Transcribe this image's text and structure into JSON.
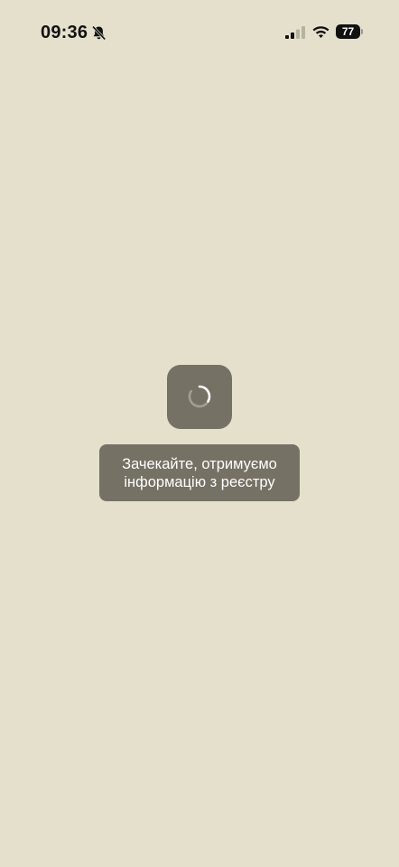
{
  "status_bar": {
    "time": "09:36",
    "mute_icon": "bell-slash-icon",
    "signal_icon": "cellular-signal-icon",
    "wifi_icon": "wifi-icon",
    "battery_percent": "77"
  },
  "loader": {
    "icon": "spinner-icon"
  },
  "toast": {
    "line1": "Зачекайте, отримуємо",
    "line2": "інформацію з реєстру"
  },
  "colors": {
    "background": "#e4e0cc",
    "overlay": "#767165",
    "text_on_overlay": "#ffffff"
  }
}
